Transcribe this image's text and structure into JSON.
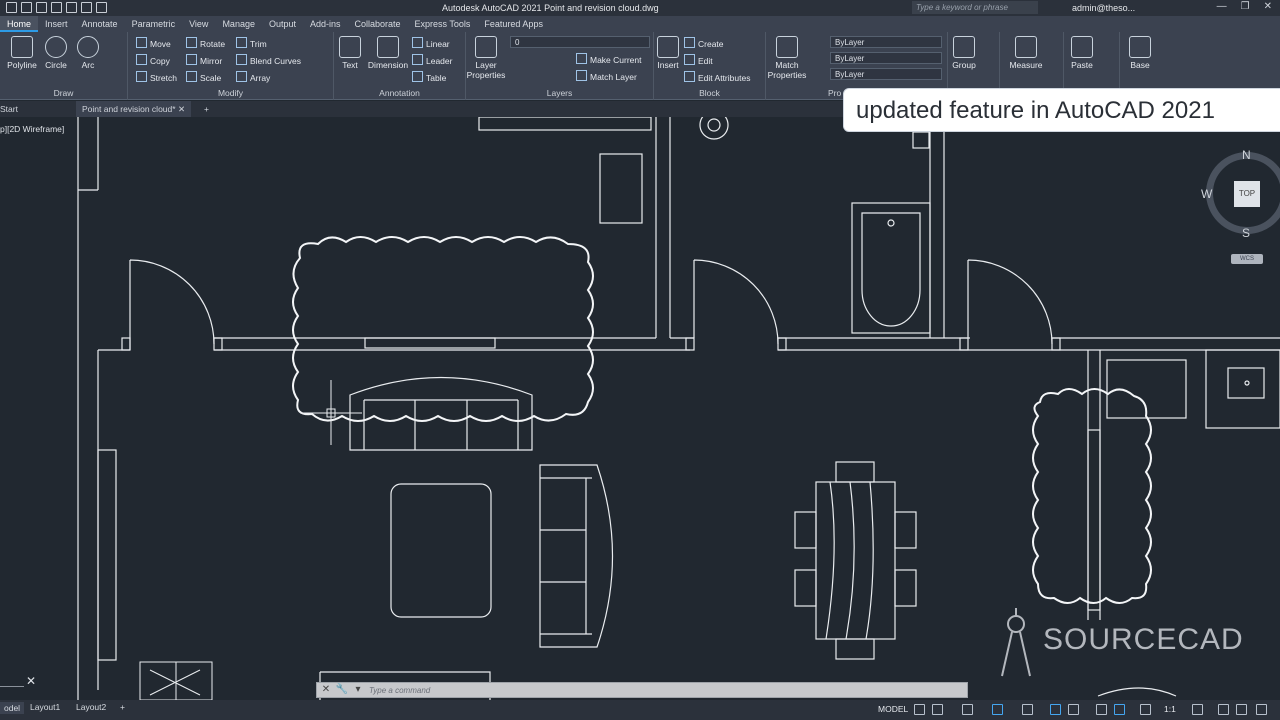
{
  "titlebar": {
    "app_title": "Autodesk AutoCAD 2021   Point and revision cloud.dwg",
    "search_placeholder": "Type a keyword or phrase",
    "user": "admin@theso..."
  },
  "ribbon_tabs": [
    "Home",
    "Insert",
    "Annotate",
    "Parametric",
    "View",
    "Manage",
    "Output",
    "Add-ins",
    "Collaborate",
    "Express Tools",
    "Featured Apps"
  ],
  "ribbon": {
    "draw": {
      "title": "Draw",
      "tools": [
        "Polyline",
        "Circle",
        "Arc"
      ]
    },
    "modify": {
      "title": "Modify",
      "rows": [
        [
          "Move",
          "Rotate",
          "Trim"
        ],
        [
          "Copy",
          "Mirror",
          "Blend Curves"
        ],
        [
          "Stretch",
          "Scale",
          "Array"
        ]
      ]
    },
    "annotation": {
      "title": "Annotation",
      "big": [
        "Text",
        "Dimension"
      ],
      "small": [
        "Linear",
        "Leader",
        "Table"
      ]
    },
    "layers": {
      "title": "Layers",
      "big": "Layer Properties",
      "layer_value": "0",
      "small": [
        "Make Current",
        "Match Layer"
      ]
    },
    "block": {
      "title": "Block",
      "big": "Insert",
      "small": [
        "Create",
        "Edit",
        "Edit Attributes"
      ]
    },
    "properties": {
      "title": "Pro",
      "big": "Match Properties",
      "combos": [
        "ByLayer",
        "ByLayer",
        "ByLayer"
      ]
    },
    "groups": {
      "big": "Group"
    },
    "utilities": {
      "big": "Measure"
    },
    "clipboard": {
      "big": "Paste"
    },
    "view": {
      "big": "Base"
    }
  },
  "file_tabs": {
    "start": "Start",
    "active": "Point and revision cloud*"
  },
  "viewport_label": "p][2D Wireframe]",
  "overlay_text": "updated feature in AutoCAD 2021",
  "viewcube": {
    "top": "TOP",
    "n": "N",
    "s": "S",
    "w": "W",
    "wcs": "WCS"
  },
  "watermark": "SOURCECAD",
  "command": {
    "placeholder": "Type a command"
  },
  "status": {
    "model_tab": "odel",
    "layouts": [
      "Layout1",
      "Layout2"
    ],
    "model": "MODEL",
    "scale": "1:1"
  }
}
